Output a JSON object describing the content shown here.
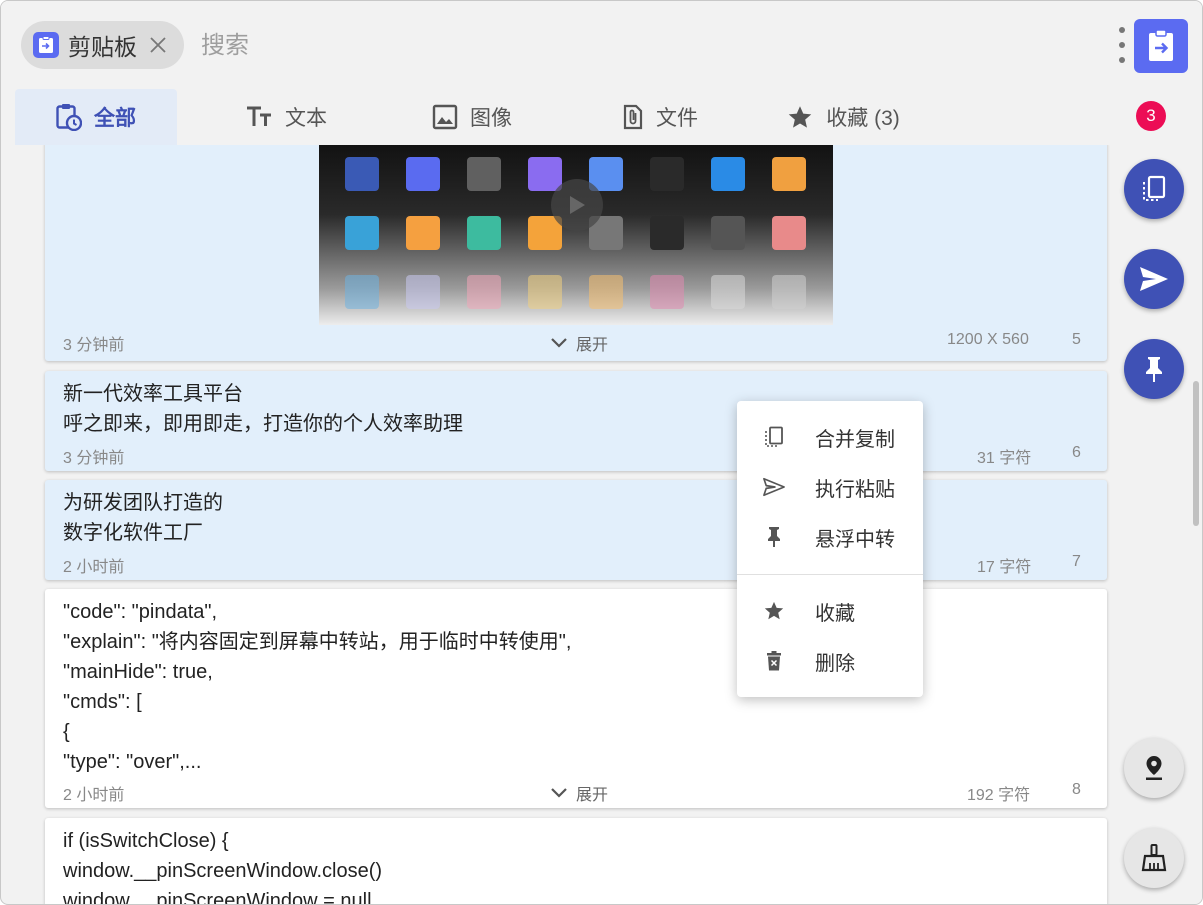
{
  "header": {
    "chip_label": "剪贴板",
    "search_placeholder": "搜索"
  },
  "tabs": [
    {
      "label": "全部",
      "icon": "clipboard-clock-icon",
      "active": true
    },
    {
      "label": "文本",
      "icon": "text-size-icon"
    },
    {
      "label": "图像",
      "icon": "image-icon"
    },
    {
      "label": "文件",
      "icon": "paperclip-file-icon"
    },
    {
      "label": "收藏 (3)",
      "icon": "star-icon"
    }
  ],
  "badge_count": "3",
  "items": [
    {
      "time": "3 分钟前",
      "expand": "展开",
      "size": "1200 X 560",
      "index": "5"
    },
    {
      "text": "新一代效率工具平台\n呼之即来，即用即走，打造你的个人效率助理",
      "time": "3 分钟前",
      "size": "31 字符",
      "index": "6"
    },
    {
      "text": "为研发团队打造的\n数字化软件工厂",
      "time": "2 小时前",
      "size": "17 字符",
      "index": "7"
    },
    {
      "text": "\"code\": \"pindata\",\n\"explain\": \"将内容固定到屏幕中转站，用于临时中转使用\",\n\"mainHide\": true,\n\"cmds\": [\n{\n\"type\": \"over\",...",
      "time": "2 小时前",
      "expand": "展开",
      "size": "192 字符",
      "index": "8"
    },
    {
      "text": "if (isSwitchClose) {\nwindow.__pinScreenWindow.close()\nwindow.__pinScreenWindow = null"
    }
  ],
  "context_menu": [
    {
      "label": "合并复制",
      "icon": "merge-copy-icon"
    },
    {
      "label": "执行粘贴",
      "icon": "send-icon"
    },
    {
      "label": "悬浮中转",
      "icon": "pin-icon"
    },
    {
      "label": "收藏",
      "icon": "star-icon"
    },
    {
      "label": "删除",
      "icon": "trash-icon"
    }
  ],
  "colors": {
    "accent": "#3f51b5",
    "app_icon": "#5b6bf1",
    "badge": "#ec0d55",
    "selected_card": "#e2effb"
  }
}
